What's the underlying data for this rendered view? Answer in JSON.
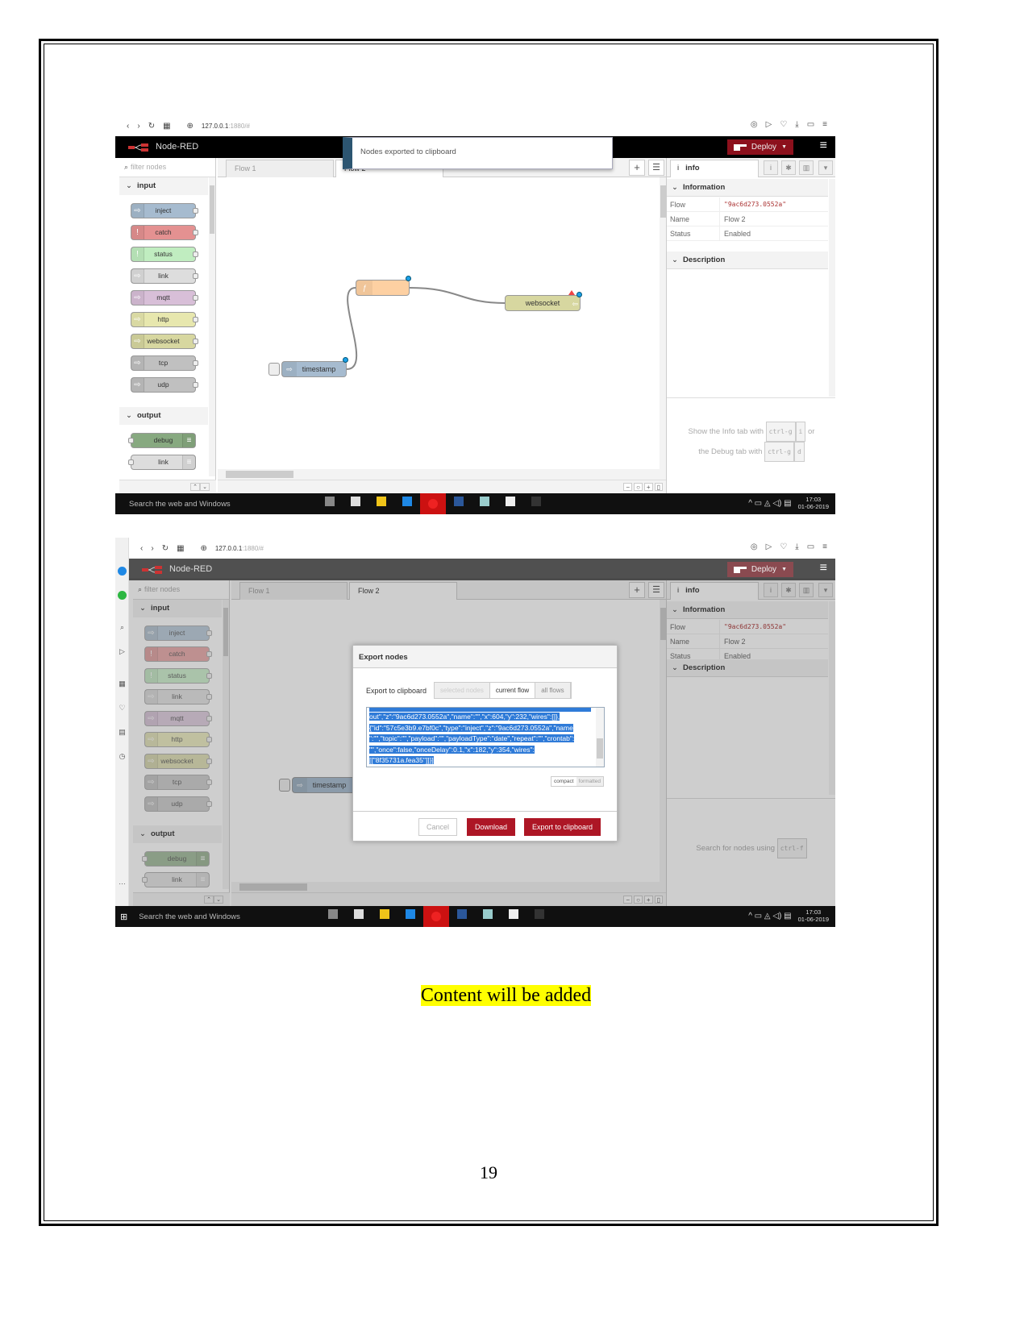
{
  "browser": {
    "url_host": "127.0.0.1",
    "url_rest": ":1880/#",
    "left_icons": [
      "back-icon",
      "forward-icon",
      "reload-icon",
      "apps-icon",
      "globe-icon"
    ],
    "right_icons": [
      "camera-icon",
      "play-icon",
      "heart-icon",
      "download-icon",
      "battery-icon",
      "menu-icon"
    ]
  },
  "app": {
    "title": "Node-RED",
    "deploy": "Deploy"
  },
  "palette": {
    "filter_placeholder": "filter nodes",
    "categories": [
      {
        "label": "input",
        "nodes": [
          {
            "label": "inject",
            "color": "#a6bbcf"
          },
          {
            "label": "catch",
            "color": "#e49191"
          },
          {
            "label": "status",
            "color": "#c0edc0"
          },
          {
            "label": "link",
            "color": "#dddddd"
          },
          {
            "label": "mqtt",
            "color": "#d8bfd8"
          },
          {
            "label": "http",
            "color": "#e7e7ae"
          },
          {
            "label": "websocket",
            "color": "#d7d7a0"
          },
          {
            "label": "tcp",
            "color": "#c0c0c0"
          },
          {
            "label": "udp",
            "color": "#c0c0c0"
          }
        ]
      },
      {
        "label": "output",
        "nodes": [
          {
            "label": "debug",
            "color": "#87a980"
          },
          {
            "label": "link",
            "color": "#dddddd"
          }
        ]
      }
    ]
  },
  "tabs": [
    "Flow 1",
    "Flow 2"
  ],
  "sidebar": {
    "tab": "info",
    "section_info": "Information",
    "rows": [
      {
        "key": "Flow",
        "value": "\"9ac6d273.0552a\""
      },
      {
        "key": "Name",
        "value": "Flow 2"
      },
      {
        "key": "Status",
        "value": "Enabled"
      }
    ],
    "section_desc": "Description"
  },
  "screenshot1": {
    "toast": "Nodes exported to clipboard",
    "flow_nodes": {
      "function_icon": "ƒ",
      "websocket": "websocket",
      "timestamp": "timestamp"
    },
    "help": {
      "line1": "Show the Info tab with",
      "key1": "ctrl-g",
      "key1b": "i",
      "or": "or",
      "line2": "the Debug tab with",
      "key2": "ctrl-g",
      "key2b": "d"
    }
  },
  "screenshot2": {
    "flow_nodes": {
      "timestamp": "timestamp"
    },
    "help": {
      "line1": "Search for nodes using",
      "key1": "ctrl-f"
    },
    "dialog": {
      "title": "Export nodes",
      "export_label": "Export to clipboard",
      "scope_options": [
        "selected nodes",
        "current flow",
        "all flows"
      ],
      "selected_scope": "current flow",
      "json_lines": [
        "out\",\"z\":\"9ac6d273.0552a\",\"name\":\"\",\"x\":604,\"y\":232,\"wires\":[]},",
        "{\"id\":\"57c5e3b9.e7bf0c\",\"type\":\"inject\",\"z\":\"9ac6d273.0552a\",\"name",
        "\":\"\",\"topic\":\"\",\"payload\":\"\",\"payloadType\":\"date\",\"repeat\":\"\",\"crontab\":",
        "\"\",\"once\":false,\"onceDelay\":0.1,\"x\":182,\"y\":354,\"wires\":",
        "[[\"8f35731a.fea35\"]]}]"
      ],
      "format_options": [
        "compact",
        "formatted"
      ],
      "selected_format": "compact",
      "cancel": "Cancel",
      "download": "Download",
      "export": "Export to clipboard"
    }
  },
  "taskbar": {
    "search": "Search the web and Windows",
    "time": "17:03",
    "date": "01-06-2019",
    "app_colors": [
      "#888",
      "#ddd",
      "#f0c419",
      "#1e88e5",
      "#e22",
      "#2b579a",
      "#9cc",
      "#eee",
      "#333"
    ]
  },
  "document": {
    "highlight": "Content will be added",
    "page_number": "19"
  }
}
